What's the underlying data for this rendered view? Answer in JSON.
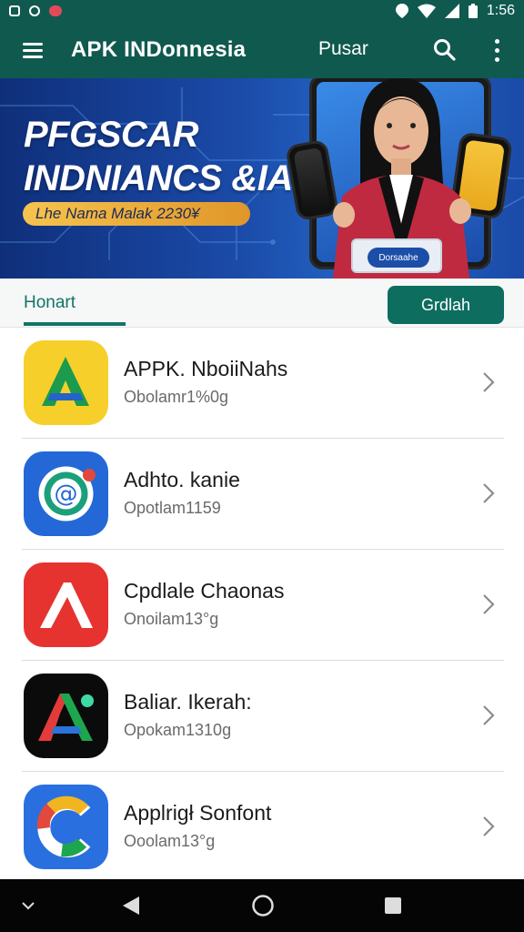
{
  "status_bar": {
    "time": "1:56",
    "icons": [
      "sim-icon",
      "cloud-icon",
      "heart-icon",
      "location-icon",
      "wifi-icon",
      "signal-icon",
      "battery-icon"
    ]
  },
  "app_bar": {
    "title": "APK INDonnesia",
    "link_label": "Pusar",
    "icons": [
      "menu-icon",
      "search-icon",
      "more-vert-icon"
    ]
  },
  "banner": {
    "headline_line1": "PFGSCAR",
    "headline_line2": "INDNIANCS &IA",
    "pill_text": "Lhe Nama Malak 2230¥",
    "sign_text": "Dorsaahe",
    "colors": {
      "bg": "#1b4aa8",
      "pill": "#f6c34e"
    }
  },
  "tabs": {
    "active_label": "Honart",
    "button_label": "Grdlah"
  },
  "apps": [
    {
      "name": "APPK. NboiiNahs",
      "subtitle": "Obolamr1%0g",
      "icon": "yellow-a-icon"
    },
    {
      "name": "Adhto. kanie",
      "subtitle": "Opotlam1159",
      "icon": "blue-at-icon"
    },
    {
      "name": "Cpdlale Chaonas",
      "subtitle": "Onoilam13°g",
      "icon": "red-a-icon"
    },
    {
      "name": "Baliar. Ikerah:",
      "subtitle": "Opokam1310g",
      "icon": "black-a-icon"
    },
    {
      "name": "Applrigł Sonfont",
      "subtitle": "Ooolam13°g",
      "icon": "blue-c-icon"
    }
  ],
  "nav_bar": {
    "icons": [
      "collapse-icon",
      "back-icon",
      "home-icon",
      "recents-icon"
    ]
  },
  "accent": "#10594f"
}
